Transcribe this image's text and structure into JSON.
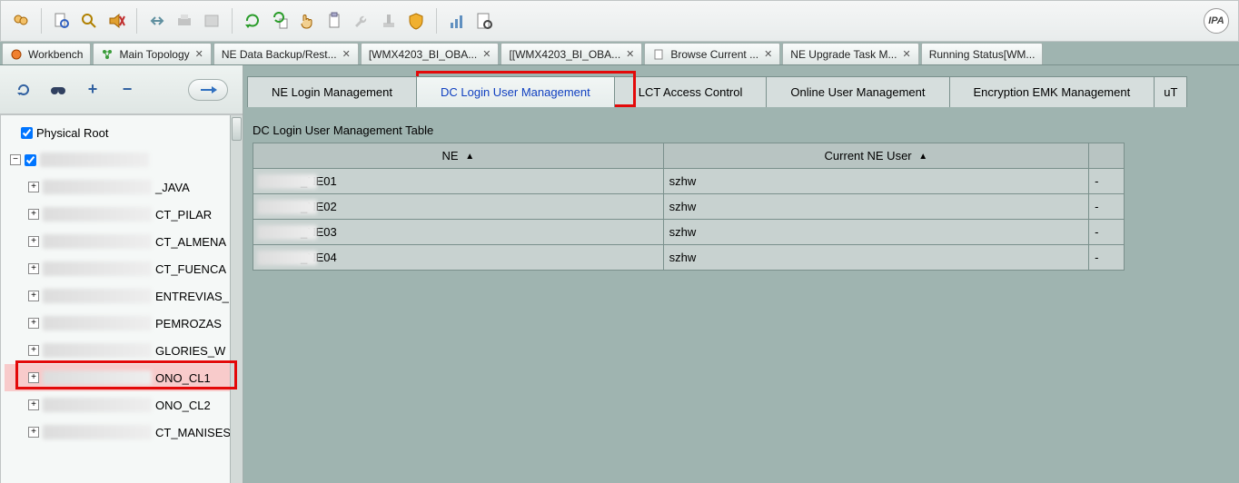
{
  "toolbar": {
    "ipa_label": "IPA"
  },
  "doc_tabs": [
    {
      "label": "Workbench",
      "closable": false,
      "icon": "globe"
    },
    {
      "label": "Main Topology",
      "closable": true,
      "icon": "topo"
    },
    {
      "label": "NE Data Backup/Rest...",
      "closable": true,
      "icon": ""
    },
    {
      "label": "[WMX4203_BI_OBA...",
      "closable": true,
      "icon": ""
    },
    {
      "label": "[[WMX4203_BI_OBA...",
      "closable": true,
      "icon": ""
    },
    {
      "label": "Browse Current ...",
      "closable": true,
      "icon": "doc"
    },
    {
      "label": "NE Upgrade Task M...",
      "closable": true,
      "icon": ""
    },
    {
      "label": "Running Status[WM...",
      "closable": false,
      "icon": ""
    }
  ],
  "left_tools": {
    "arrow_label": "→"
  },
  "tree": {
    "root_label": "Physical Root",
    "root_checked": true,
    "child_checked": true,
    "items": [
      {
        "suffix": "_JAVA"
      },
      {
        "suffix": "CT_PILAR"
      },
      {
        "suffix": "CT_ALMENA"
      },
      {
        "suffix": "CT_FUENCA"
      },
      {
        "suffix": "ENTREVIAS_"
      },
      {
        "suffix": "PEMROZAS"
      },
      {
        "suffix": "GLORIES_W"
      },
      {
        "suffix": "ONO_CL1",
        "highlight": true
      },
      {
        "suffix": "ONO_CL2"
      },
      {
        "suffix": "CT_MANISES"
      }
    ]
  },
  "inner_tabs": [
    {
      "label": "NE Login Management",
      "active": false
    },
    {
      "label": "DC Login User Management",
      "active": true
    },
    {
      "label": "LCT Access Control",
      "active": false
    },
    {
      "label": "Online User Management",
      "active": false
    },
    {
      "label": "Encryption EMK Management",
      "active": false
    },
    {
      "label": "uT",
      "active": false
    }
  ],
  "table": {
    "title": "DC Login User Management Table",
    "columns": [
      "NE",
      "Current NE User",
      ""
    ],
    "sort_glyph": "▲",
    "rows": [
      {
        "ne": "_NE01",
        "user": "szhw",
        "c3": "-"
      },
      {
        "ne": "_NE02",
        "user": "szhw",
        "c3": "-"
      },
      {
        "ne": "_NE03",
        "user": "szhw",
        "c3": "-"
      },
      {
        "ne": "_NE04",
        "user": "szhw",
        "c3": "-"
      }
    ]
  }
}
